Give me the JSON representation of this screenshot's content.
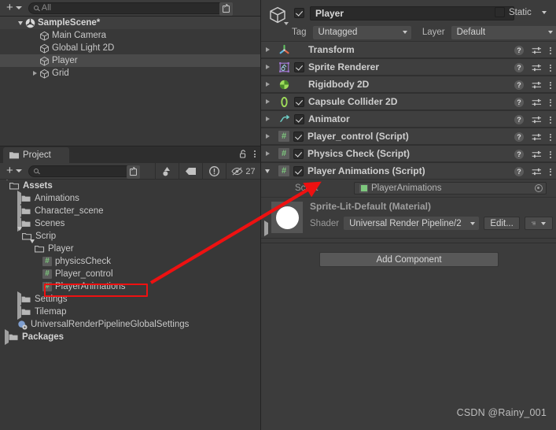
{
  "hierarchy": {
    "toolbar": {
      "add_label": "+",
      "search_placeholder": "All",
      "search_value": ""
    },
    "rows": [
      {
        "label": "SampleScene*",
        "icon": "unity-scene-icon",
        "depth": 0,
        "expanded": true,
        "state": "scene"
      },
      {
        "label": "Main Camera",
        "icon": "gameobject-cube-icon",
        "depth": 1,
        "expanded": null,
        "state": "normal"
      },
      {
        "label": "Global Light 2D",
        "icon": "gameobject-cube-icon",
        "depth": 1,
        "expanded": null,
        "state": "normal"
      },
      {
        "label": "Player",
        "icon": "gameobject-cube-icon",
        "depth": 1,
        "expanded": null,
        "state": "selected"
      },
      {
        "label": "Grid",
        "icon": "gameobject-cube-icon",
        "depth": 1,
        "expanded": false,
        "state": "normal"
      }
    ]
  },
  "project": {
    "tab_label": "Project",
    "toolbar": {
      "add_label": "+",
      "search_placeholder": "",
      "search_value": "",
      "hidden_count": "27"
    },
    "rows": [
      {
        "label": "Assets",
        "icon": "folder-open-icon",
        "depth": 0,
        "expanded": true,
        "bold": true
      },
      {
        "label": "Animations",
        "icon": "folder-icon",
        "depth": 1,
        "expanded": false,
        "bold": false
      },
      {
        "label": "Character_scene",
        "icon": "folder-icon",
        "depth": 1,
        "expanded": false,
        "bold": false
      },
      {
        "label": "Scenes",
        "icon": "folder-icon",
        "depth": 1,
        "expanded": false,
        "bold": false
      },
      {
        "label": "Scrip",
        "icon": "folder-open-icon",
        "depth": 1,
        "expanded": true,
        "bold": false
      },
      {
        "label": "Player",
        "icon": "folder-open-icon",
        "depth": 2,
        "expanded": true,
        "bold": false
      },
      {
        "label": "physicsCheck",
        "icon": "csharp-script-icon",
        "depth": 3,
        "expanded": null,
        "bold": false
      },
      {
        "label": "Player_control",
        "icon": "csharp-script-icon",
        "depth": 3,
        "expanded": null,
        "bold": false
      },
      {
        "label": "PlayerAnimations",
        "icon": "csharp-script-icon",
        "depth": 3,
        "expanded": null,
        "bold": false,
        "highlighted": true
      },
      {
        "label": "Settings",
        "icon": "folder-icon",
        "depth": 1,
        "expanded": false,
        "bold": false
      },
      {
        "label": "Tilemap",
        "icon": "folder-icon",
        "depth": 1,
        "expanded": false,
        "bold": false
      },
      {
        "label": "UniversalRenderPipelineGlobalSettings",
        "icon": "asset-settings-icon",
        "depth": 1,
        "expanded": null,
        "bold": false
      },
      {
        "label": "Packages",
        "icon": "folder-icon",
        "depth": 0,
        "expanded": false,
        "bold": true
      }
    ]
  },
  "inspector": {
    "object_name": "Player",
    "object_enabled": true,
    "static_label": "Static",
    "static_checked": false,
    "tag_label": "Tag",
    "tag_value": "Untagged",
    "layer_label": "Layer",
    "layer_value": "Default",
    "components": [
      {
        "name": "Transform",
        "icon": "transform-icon",
        "has_checkbox": false,
        "enabled": null,
        "expanded": false
      },
      {
        "name": "Sprite Renderer",
        "icon": "sprite-renderer-icon",
        "has_checkbox": true,
        "enabled": true,
        "expanded": false
      },
      {
        "name": "Rigidbody 2D",
        "icon": "rigidbody2d-icon",
        "has_checkbox": false,
        "enabled": null,
        "expanded": false
      },
      {
        "name": "Capsule Collider 2D",
        "icon": "capsule-collider2d-icon",
        "has_checkbox": true,
        "enabled": true,
        "expanded": false
      },
      {
        "name": "Animator",
        "icon": "animator-icon",
        "has_checkbox": true,
        "enabled": true,
        "expanded": false
      },
      {
        "name": "Player_control (Script)",
        "icon": "csharp-script-icon",
        "has_checkbox": true,
        "enabled": true,
        "expanded": false
      },
      {
        "name": "Physics Check (Script)",
        "icon": "csharp-script-icon",
        "has_checkbox": true,
        "enabled": true,
        "expanded": false
      },
      {
        "name": "Player Animations (Script)",
        "icon": "csharp-script-icon",
        "has_checkbox": true,
        "enabled": true,
        "expanded": true
      }
    ],
    "script_field": {
      "label": "Script",
      "value": "PlayerAnimations"
    },
    "material": {
      "title": "Sprite-Lit-Default (Material)",
      "shader_label": "Shader",
      "shader_value": "Universal Render Pipeline/2",
      "edit_label": "Edit..."
    },
    "add_component_label": "Add Component"
  },
  "annotations": {
    "watermark": "CSDN @Rainy_001",
    "highlight_color": "#ee1111"
  }
}
